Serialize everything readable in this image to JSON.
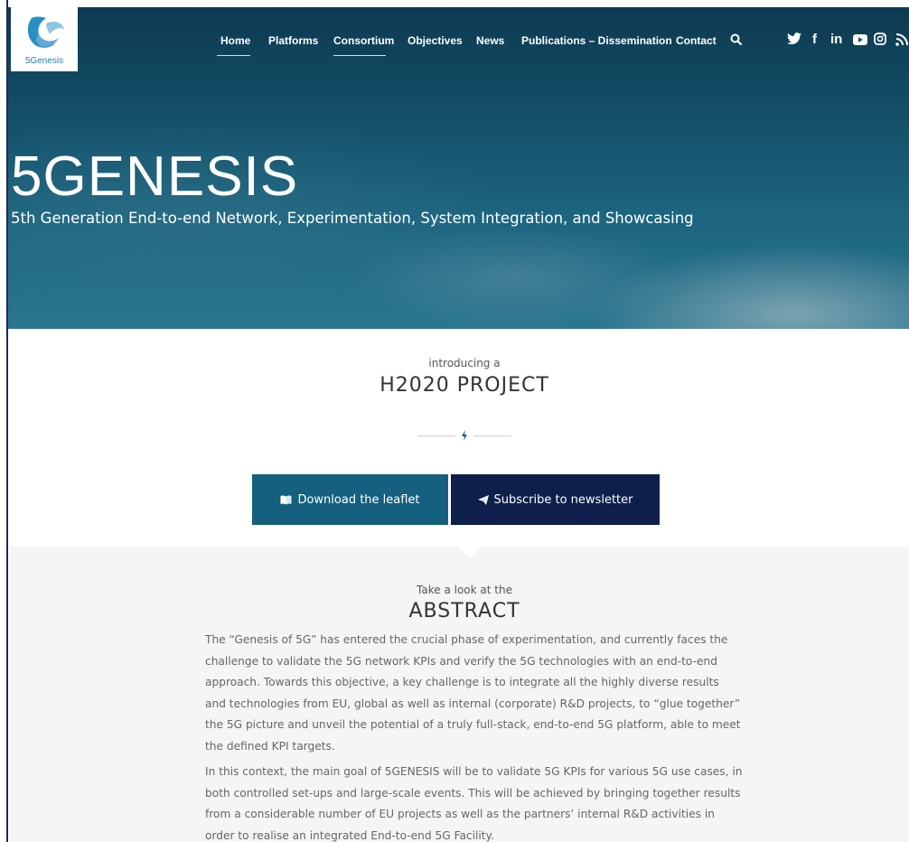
{
  "brand": {
    "logo_text": "5Genesis",
    "accent": "#14607e",
    "dark": "#0d1f4a"
  },
  "nav": {
    "items": [
      {
        "label": "Home"
      },
      {
        "label": "Platforms"
      },
      {
        "label": "Consortium"
      },
      {
        "label": "Objectives"
      },
      {
        "label": "News"
      },
      {
        "label": "Publications – Dissemination"
      },
      {
        "label": "Contact"
      }
    ],
    "search_icon": "search-icon"
  },
  "social": {
    "icons": [
      "twitter-icon",
      "facebook-icon",
      "linkedin-icon",
      "youtube-icon",
      "instagram-icon",
      "rss-icon"
    ],
    "twitter": "🐦",
    "facebook": "f",
    "linkedin": "in"
  },
  "hero": {
    "title": "5GENESIS",
    "subtitle": "5th Generation End-to-end Network, Experimentation, System Integration, and Showcasing"
  },
  "intro": {
    "small": "introducing a",
    "big": "H2020 PROJECT"
  },
  "buttons": {
    "leaflet": "Download the leaflet",
    "newsletter": "Subscribe to newsletter"
  },
  "abstract": {
    "small": "Take a look at the",
    "title": "ABSTRACT",
    "paragraph1": "The “Genesis of 5G” has entered the crucial phase of experimentation, and currently faces the challenge to validate the 5G network KPIs and verify the 5G technologies with an end-to-end approach. Towards this objective, a key challenge is to integrate all the highly diverse results and technologies from EU, global as well as internal (corporate) R&D projects, to “glue together” the 5G picture and unveil the potential of a truly full-stack, end-to-end 5G platform, able to meet the defined KPI targets.",
    "paragraph2": "In this context, the main goal of 5GENESIS will be to validate 5G KPIs for various 5G use cases, in both controlled set-ups and large-scale events. This will be achieved by bringing together results from a considerable number of EU projects as well as the partners’ internal R&D activities in order to realise an integrated End-to-end 5G Facility."
  }
}
